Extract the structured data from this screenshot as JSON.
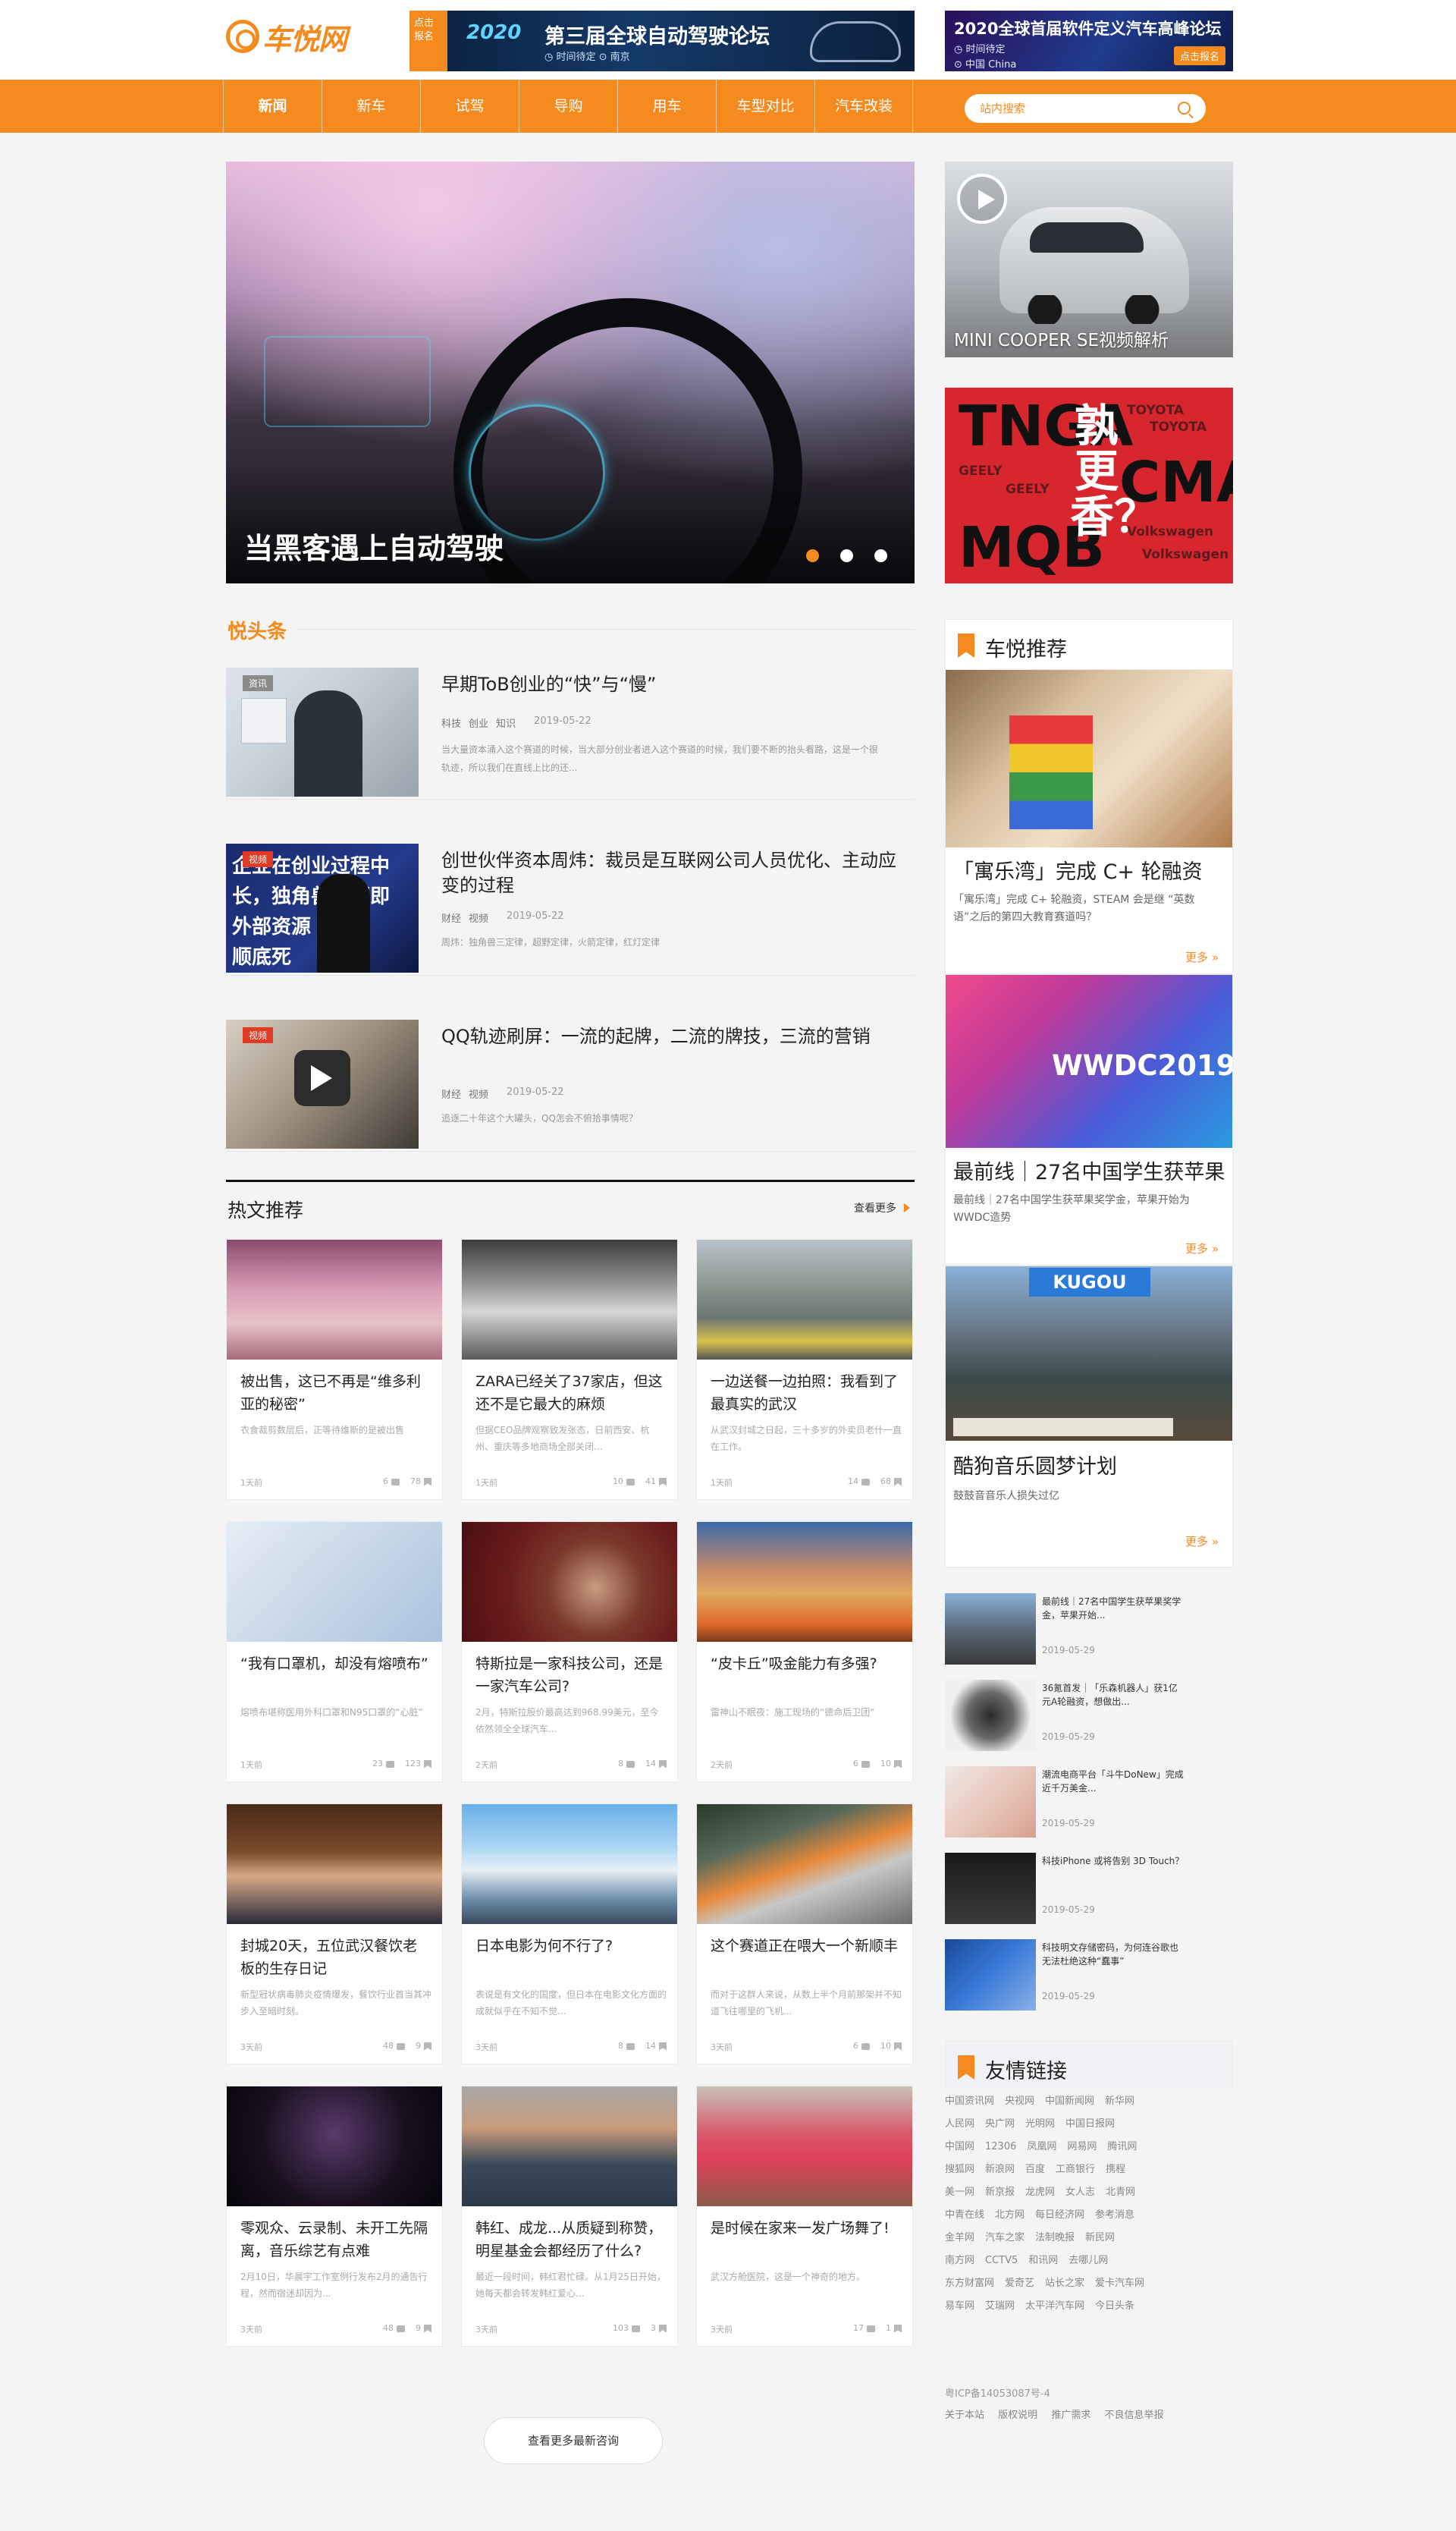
{
  "brand": {
    "logo_text": "车悦网",
    "accent": "#f58a1f"
  },
  "banners": {
    "left": {
      "tag": "点击报名",
      "year": "2020",
      "title": "第三届全球自动驾驶论坛",
      "meta": "◷ 时间待定    ⊙ 南京"
    },
    "right": {
      "title": "2020全球首届软件定义汽车高峰论坛",
      "meta1": "◷ 时间待定",
      "meta2": "⊙ 中国 China",
      "button": "点击报名"
    }
  },
  "nav": {
    "items": [
      "新闻",
      "新车",
      "试驾",
      "导购",
      "用车",
      "车型对比",
      "汽车改装"
    ],
    "active": "新闻",
    "search_placeholder": "站内搜索"
  },
  "hero": {
    "title": "当黑客遇上自动驾驶",
    "slides": 3,
    "active_slide": 1
  },
  "side_video": {
    "title": "MINI COOPER SE视频解析"
  },
  "side_promo": {
    "text_top": "TNGA",
    "text_right": "CMA",
    "text_bottom": "MQB",
    "vertical": "孰更香？",
    "brands": [
      "TOYOTA",
      "GEELY",
      "Volkswagen"
    ]
  },
  "yuetoutiao": {
    "title": "悦头条",
    "items": [
      {
        "tag": "资讯",
        "title": "早期ToB创业的“快”与“慢”",
        "tags": [
          "科技",
          "创业",
          "知识"
        ],
        "date": "2019-05-22",
        "summary": "当大量资本涌入这个赛道的时候，当大部分创业者进入这个赛道的时候，我们要不断的抬头看路，这是一个很轨迹，所以我们在直线上比的还..."
      },
      {
        "tag": "视频",
        "title": "创世伙伴资本周炜：裁员是互联网公司人员优化、主动应变的过程",
        "tags": [
          "财经",
          "视频"
        ],
        "date": "2019-05-22",
        "summary": "周炜：独角兽三定律，超野定律，火箭定律，红灯定律"
      },
      {
        "tag": "视频",
        "title": "QQ轨迹刷屏：一流的起牌，二流的牌技，三流的营销",
        "tags": [
          "财经",
          "视频"
        ],
        "date": "2019-05-22",
        "summary": "追逐二十年这个大罐头，QQ怎会不俯拾事情呢？"
      }
    ]
  },
  "hot": {
    "title": "热文推荐",
    "more": "查看更多",
    "cards": [
      {
        "title": "被出售，这已不再是“维多利亚的秘密”",
        "summary": "衣食裁剪数层后，正等待维斯的是被出售",
        "time": "1天前",
        "comments": "6",
        "favs": "78"
      },
      {
        "title": "ZARA已经关了37家店，但这还不是它最大的麻烦",
        "summary": "但据CEO品牌观察致发张态，日前西安、杭州、重庆等多地商场全部关闭...",
        "time": "1天前",
        "comments": "10",
        "favs": "41"
      },
      {
        "title": "一边送餐一边拍照：我看到了最真实的武汉",
        "summary": "从武汉封城之日起，三十多岁的外卖员老什一直在工作。",
        "time": "1天前",
        "comments": "14",
        "favs": "68"
      },
      {
        "title": "“我有口罩机，却没有熔喷布”",
        "summary": "熔喷布堪称医用外科口罩和N95口罩的“心脏”",
        "time": "1天前",
        "comments": "23",
        "favs": "123"
      },
      {
        "title": "特斯拉是一家科技公司，还是一家汽车公司?",
        "summary": "2月，特斯拉股价最高达到968.99美元，至今依然领全全球汽车...",
        "time": "2天前",
        "comments": "8",
        "favs": "14"
      },
      {
        "title": "“皮卡丘”吸金能力有多强?",
        "summary": "雷神山不眠夜：施工现场的“德命后卫团”",
        "time": "2天前",
        "comments": "6",
        "favs": "10"
      },
      {
        "title": "封城20天，五位武汉餐饮老板的生存日记",
        "summary": "新型冠状病毒肺炎疫情爆发，餐饮行业首当其冲步入至暗时刻。",
        "time": "3天前",
        "comments": "48",
        "favs": "9"
      },
      {
        "title": "日本电影为何不行了?",
        "summary": "表说是有文化的国度，但日本在电影文化方面的成就似乎在不知不觉...",
        "time": "3天前",
        "comments": "8",
        "favs": "14"
      },
      {
        "title": "这个赛道正在喂大一个新顺丰",
        "summary": "而对于这群人来说，从数上半个月前那架并不知道飞往哪里的飞机...",
        "time": "3天前",
        "comments": "6",
        "favs": "10"
      },
      {
        "title": "零观众、云录制、未开工先隔离，音乐综艺有点难",
        "summary": "2月10日，华晨宇工作室例行发布2月的通告行程，然而宿迷却因为...",
        "time": "3天前",
        "comments": "48",
        "favs": "9"
      },
      {
        "title": "韩红、成龙...从质疑到称赞，明星基金会都经历了什么?",
        "summary": "最近一段时间，韩红君忙碌。从1月25日开始，她每天都会转发韩红爱心...",
        "time": "3天前",
        "comments": "103",
        "favs": "3"
      },
      {
        "title": "是时候在家来一发广场舞了!",
        "summary": "武汉方舱医院，这是一个神奇的地方。",
        "time": "3天前",
        "comments": "17",
        "favs": "1"
      }
    ],
    "load_more": "查看更多最新咨询"
  },
  "recommend": {
    "title": "车悦推荐",
    "items": [
      {
        "title": "「寓乐湾」完成 C+ 轮融资",
        "summary": "「寓乐湾」完成 C+ 轮融资，STEAM 会是继 “英数语”之后的第四大教育赛道吗？",
        "more": "更多"
      },
      {
        "title": "最前线｜27名中国学生获苹果",
        "summary": "最前线｜27名中国学生获苹果奖学金，苹果开始为WWDC造势",
        "more": "更多",
        "img_text": "WWDC2019"
      },
      {
        "title": "酷狗音乐圆梦计划",
        "summary": "鼓鼓音音乐人损失过亿",
        "more": "更多",
        "img_text": "KUGOU"
      }
    ]
  },
  "mini_news": [
    {
      "title": "最前线｜27名中国学生获苹果奖学金，苹果开始...",
      "date": "2019-05-29"
    },
    {
      "title": "36氪首发｜「乐森机器人」获1亿元A轮融资，想做出...",
      "date": "2019-05-29"
    },
    {
      "title": "潮流电商平台「斗牛DoNew」完成近千万美金...",
      "date": "2019-05-29"
    },
    {
      "title": "科技iPhone 或将告别 3D Touch？",
      "date": "2019-05-29"
    },
    {
      "title": "科技明文存储密码，为何连谷歌也无法杜绝这种“蠢事”",
      "date": "2019-05-29"
    }
  ],
  "friend_links": {
    "title": "友情链接",
    "rows": [
      [
        "中国资讯网",
        "央视网",
        "中国新闻网",
        "新华网"
      ],
      [
        "人民网",
        "央广网",
        "光明网",
        "中国日报网"
      ],
      [
        "中国网",
        "12306",
        "凤凰网",
        "网易网",
        "腾讯网"
      ],
      [
        "搜狐网",
        "新浪网",
        "百度",
        "工商银行",
        "携程"
      ],
      [
        "美一网",
        "新京报",
        "龙虎网",
        "女人志",
        "北青网"
      ],
      [
        "中青在线",
        "北方网",
        "每日经济网",
        "参考消息"
      ],
      [
        "金羊网",
        "汽车之家",
        "法制晚报",
        "新民网"
      ],
      [
        "南方网",
        "CCTV5",
        "和讯网",
        "去哪儿网"
      ],
      [
        "东方财富网",
        "爱奇艺",
        "站长之家",
        "爱卡汽车网"
      ],
      [
        "易车网",
        "艾瑞网",
        "太平洋汽车网",
        "今日头条"
      ]
    ]
  },
  "footer": {
    "icp": "粤ICP备14053087号-4",
    "links": [
      "关于本站",
      "版权说明",
      "推广需求",
      "不良信息举报"
    ]
  }
}
